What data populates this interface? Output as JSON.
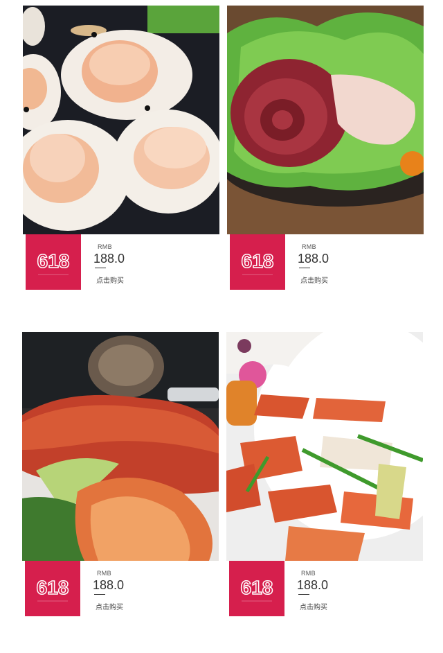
{
  "products": [
    {
      "image_alt": "scallops",
      "badge_text": "618",
      "unit": "RMB",
      "price": "188.0",
      "buy_label": "点击购买"
    },
    {
      "image_alt": "octopus",
      "badge_text": "618",
      "unit": "RMB",
      "price": "188.0",
      "buy_label": "点击购买"
    },
    {
      "image_alt": "lobster",
      "badge_text": "618",
      "unit": "RMB",
      "price": "188.0",
      "buy_label": "点击购买"
    },
    {
      "image_alt": "king crab",
      "badge_text": "618",
      "unit": "RMB",
      "price": "188.0",
      "buy_label": "点击购买"
    }
  ],
  "colors": {
    "badge": "#d61f4d",
    "text": "#333333"
  }
}
